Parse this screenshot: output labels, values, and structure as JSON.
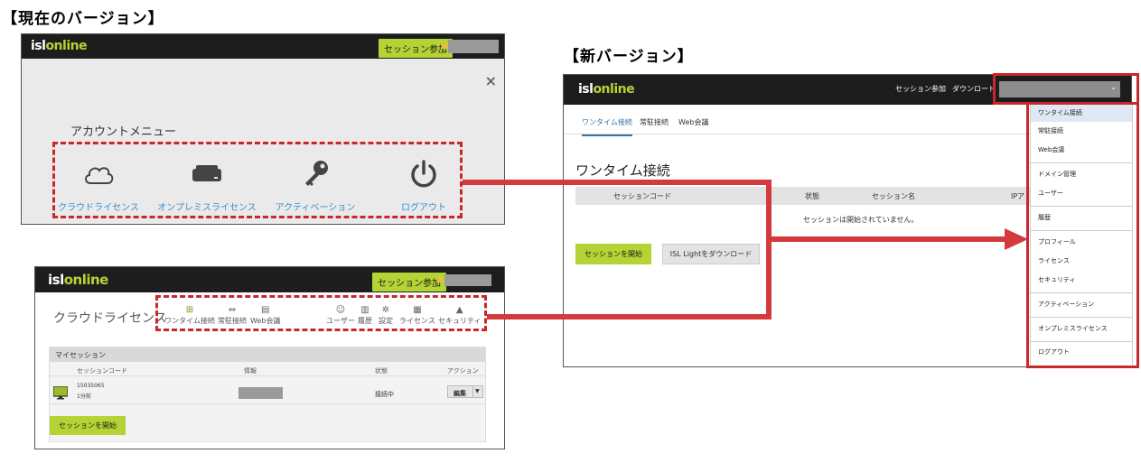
{
  "headings": {
    "current": "【現在のバージョン】",
    "new": "【新バージョン】"
  },
  "brand": {
    "isl": "isl",
    "online": "online"
  },
  "old_account_menu": {
    "join_button": "セッション参加",
    "title": "アカウントメニュー",
    "close_icon": "×",
    "items": [
      {
        "label": "クラウドライセンス",
        "icon": "cloud-icon"
      },
      {
        "label": "オンプレミスライセンス",
        "icon": "server-icon"
      },
      {
        "label": "アクティベーション",
        "icon": "key-icon"
      },
      {
        "label": "ログアウト",
        "icon": "power-icon"
      }
    ]
  },
  "old_cloud_page": {
    "join_button": "セッション参加",
    "title": "クラウドライセンス",
    "nav_left": [
      {
        "label": "ワンタイム接続",
        "icon": "monitor-plus-icon",
        "glyph": "⊞"
      },
      {
        "label": "常駐接続",
        "icon": "arrows-icon",
        "glyph": "⇔"
      },
      {
        "label": "Web会議",
        "icon": "meeting-icon",
        "glyph": "▤"
      }
    ],
    "nav_right": [
      {
        "label": "ユーザー",
        "icon": "users-icon",
        "glyph": "☺"
      },
      {
        "label": "履歴",
        "icon": "bar-chart-icon",
        "glyph": "▥"
      },
      {
        "label": "設定",
        "icon": "gear-icon",
        "glyph": "✲"
      },
      {
        "label": "ライセンス",
        "icon": "license-icon",
        "glyph": "▦"
      },
      {
        "label": "セキュリティ",
        "icon": "lock-icon",
        "glyph": "▲"
      }
    ],
    "panel_title": "マイセッション",
    "columns": [
      "セッションコード",
      "情報",
      "状態",
      "アクション"
    ],
    "row": {
      "code": "15035065",
      "age": "1分前",
      "status": "接続中",
      "action": "編集"
    },
    "start_button": "セッションを開始"
  },
  "new_version": {
    "top_links": [
      "セッション参加",
      "ダウンロード"
    ],
    "tabs": [
      "ワンタイム接続",
      "常駐接続",
      "Web会議"
    ],
    "title": "ワンタイム接続",
    "columns": [
      "セッションコード",
      "状態",
      "セッション名",
      "IPア"
    ],
    "empty_text": "セッションは開始されていません。",
    "start_button": "セッションを開始",
    "download_button": "ISL Lightをダウンロード",
    "dropdown": [
      "ワンタイム接続",
      "常駐接続",
      "Web会議",
      "ドメイン管理",
      "ユーザー",
      "履歴",
      "プロフィール",
      "ライセンス",
      "セキュリティ",
      "アクティベーション",
      "オンプレミスライセンス",
      "ログアウト"
    ]
  },
  "colors": {
    "brand_green": "#b5d334",
    "highlight_red": "#c8282b",
    "link_blue": "#3a8fd0",
    "topbar": "#1d1d1d"
  }
}
